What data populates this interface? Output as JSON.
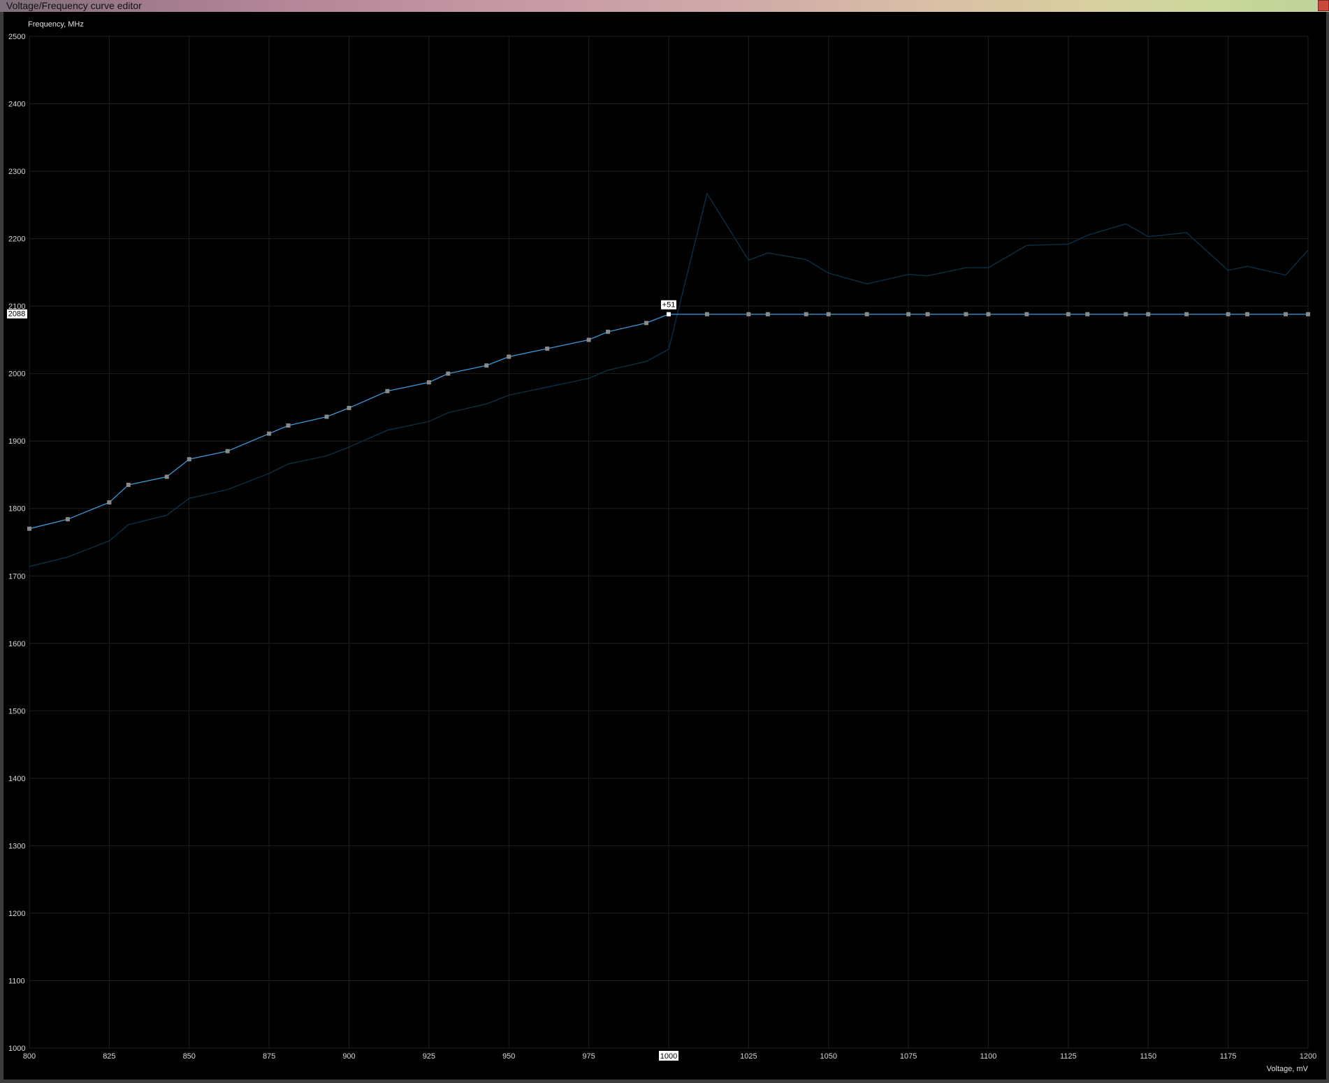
{
  "window": {
    "title": "Voltage/Frequency curve editor"
  },
  "colors": {
    "background": "#000000",
    "grid": "#1e1e1e",
    "curve": "#3a9ad9",
    "reference_curve": "#0d2c40",
    "point": "#8a8a8a",
    "selected_point": "#ffffff",
    "label_box": "#ffffff"
  },
  "chart_data": {
    "type": "line",
    "ylabel": "Frequency, MHz",
    "xlabel": "Voltage, mV",
    "xlim": [
      800,
      1200
    ],
    "ylim": [
      1000,
      2500
    ],
    "x_ticks": [
      800,
      825,
      850,
      875,
      900,
      925,
      950,
      975,
      1000,
      1025,
      1050,
      1075,
      1100,
      1125,
      1150,
      1175,
      1200
    ],
    "y_ticks": [
      1000,
      1100,
      1200,
      1300,
      1400,
      1500,
      1600,
      1700,
      1800,
      1900,
      2000,
      2100,
      2200,
      2300,
      2400,
      2500
    ],
    "grid": true,
    "selected_point": {
      "x": 1000,
      "y": 2088,
      "offset_label": "+51",
      "y_label": "2088",
      "x_label": "1000"
    },
    "series": [
      {
        "role": "curve",
        "points": [
          [
            800,
            1770
          ],
          [
            812,
            1784
          ],
          [
            825,
            1809
          ],
          [
            831,
            1835
          ],
          [
            843,
            1847
          ],
          [
            850,
            1873
          ],
          [
            862,
            1885
          ],
          [
            875,
            1911
          ],
          [
            881,
            1923
          ],
          [
            893,
            1936
          ],
          [
            900,
            1949
          ],
          [
            912,
            1974
          ],
          [
            925,
            1987
          ],
          [
            931,
            2000
          ],
          [
            943,
            2012
          ],
          [
            950,
            2025
          ],
          [
            962,
            2037
          ],
          [
            975,
            2050
          ],
          [
            981,
            2062
          ],
          [
            993,
            2075
          ],
          [
            1000,
            2088
          ],
          [
            1012,
            2088
          ],
          [
            1025,
            2088
          ],
          [
            1031,
            2088
          ],
          [
            1043,
            2088
          ],
          [
            1050,
            2088
          ],
          [
            1062,
            2088
          ],
          [
            1075,
            2088
          ],
          [
            1081,
            2088
          ],
          [
            1093,
            2088
          ],
          [
            1100,
            2088
          ],
          [
            1112,
            2088
          ],
          [
            1125,
            2088
          ],
          [
            1131,
            2088
          ],
          [
            1143,
            2088
          ],
          [
            1150,
            2088
          ],
          [
            1162,
            2088
          ],
          [
            1175,
            2088
          ],
          [
            1181,
            2088
          ],
          [
            1193,
            2088
          ],
          [
            1200,
            2088
          ]
        ]
      },
      {
        "role": "reference",
        "points": [
          [
            800,
            1714
          ],
          [
            812,
            1728
          ],
          [
            825,
            1752
          ],
          [
            831,
            1776
          ],
          [
            843,
            1790
          ],
          [
            850,
            1815
          ],
          [
            862,
            1828
          ],
          [
            875,
            1852
          ],
          [
            881,
            1866
          ],
          [
            893,
            1878
          ],
          [
            900,
            1891
          ],
          [
            912,
            1916
          ],
          [
            925,
            1929
          ],
          [
            931,
            1942
          ],
          [
            943,
            1955
          ],
          [
            950,
            1968
          ],
          [
            962,
            1980
          ],
          [
            975,
            1993
          ],
          [
            981,
            2005
          ],
          [
            993,
            2018
          ],
          [
            1000,
            2036
          ],
          [
            1012,
            2267
          ],
          [
            1025,
            2168
          ],
          [
            1031,
            2179
          ],
          [
            1043,
            2169
          ],
          [
            1050,
            2149
          ],
          [
            1062,
            2133
          ],
          [
            1075,
            2147
          ],
          [
            1081,
            2145
          ],
          [
            1093,
            2157
          ],
          [
            1100,
            2157
          ],
          [
            1112,
            2190
          ],
          [
            1125,
            2192
          ],
          [
            1131,
            2205
          ],
          [
            1143,
            2222
          ],
          [
            1150,
            2203
          ],
          [
            1162,
            2209
          ],
          [
            1175,
            2153
          ],
          [
            1181,
            2159
          ],
          [
            1193,
            2146
          ],
          [
            1200,
            2183
          ]
        ]
      }
    ]
  }
}
